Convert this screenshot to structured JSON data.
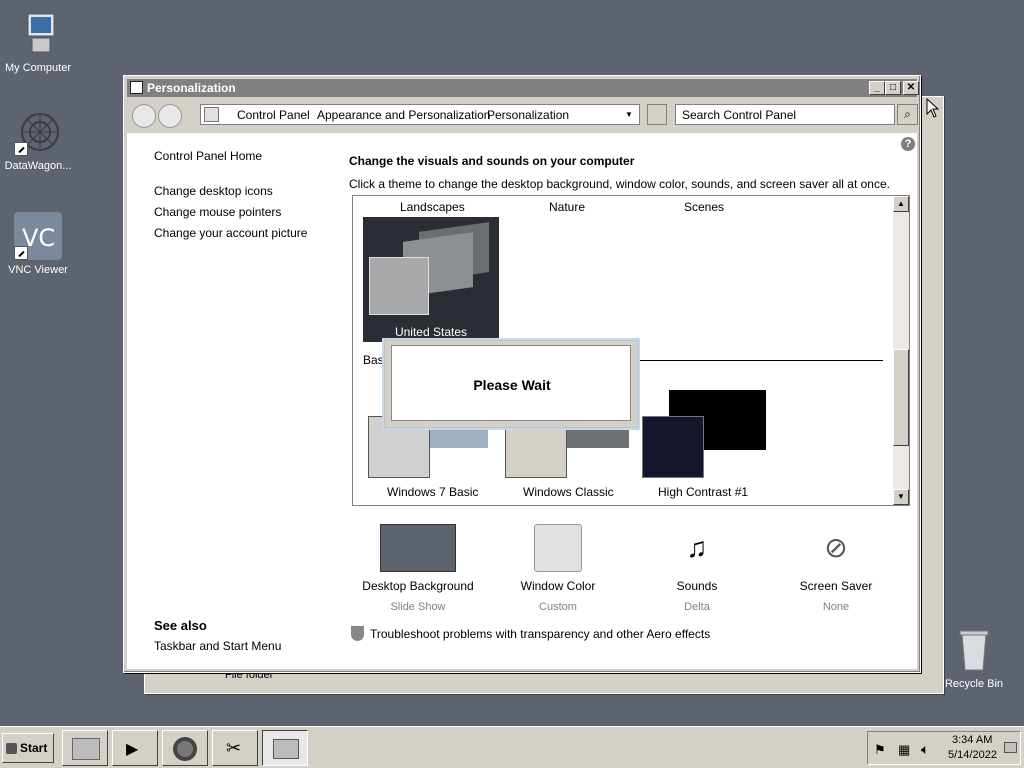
{
  "desktop": {
    "icons": [
      {
        "label": "My Computer"
      },
      {
        "label": "DataWagon..."
      },
      {
        "label": "VNC Viewer"
      },
      {
        "label": "Recycle Bin"
      }
    ]
  },
  "behind_window": {
    "file_type": "File folder"
  },
  "window": {
    "title": "Personalization",
    "controls": {
      "minimize": "_",
      "maximize": "□",
      "close": "✕"
    },
    "breadcrumb": [
      "Control Panel",
      "Appearance and Personalization",
      "Personalization"
    ],
    "search_placeholder": "Search Control Panel",
    "help": "?"
  },
  "sidebar": {
    "home": "Control Panel Home",
    "links": [
      "Change desktop icons",
      "Change mouse pointers",
      "Change your account picture"
    ],
    "see_also_title": "See also",
    "see_also_links": [
      "Taskbar and Start Menu"
    ]
  },
  "main": {
    "heading": "Change the visuals and sounds on your computer",
    "description": "Click a theme to change the desktop background, window color, sounds, and screen saver all at once.",
    "aero_themes": [
      "Landscapes",
      "Nature",
      "Scenes"
    ],
    "selected_theme": "United States",
    "basic_label": "Basic",
    "basic_themes": [
      "Windows 7 Basic",
      "Windows Classic",
      "High Contrast #1"
    ],
    "bottom": [
      {
        "label": "Desktop Background",
        "sub": "Slide Show"
      },
      {
        "label": "Window Color",
        "sub": "Custom"
      },
      {
        "label": "Sounds",
        "sub": "Delta"
      },
      {
        "label": "Screen Saver",
        "sub": "None"
      }
    ],
    "troubleshoot": "Troubleshoot problems with transparency and other Aero effects"
  },
  "dialog": {
    "text": "Please Wait"
  },
  "taskbar": {
    "start": "Start",
    "time": "3:34 AM",
    "date": "5/14/2022"
  }
}
